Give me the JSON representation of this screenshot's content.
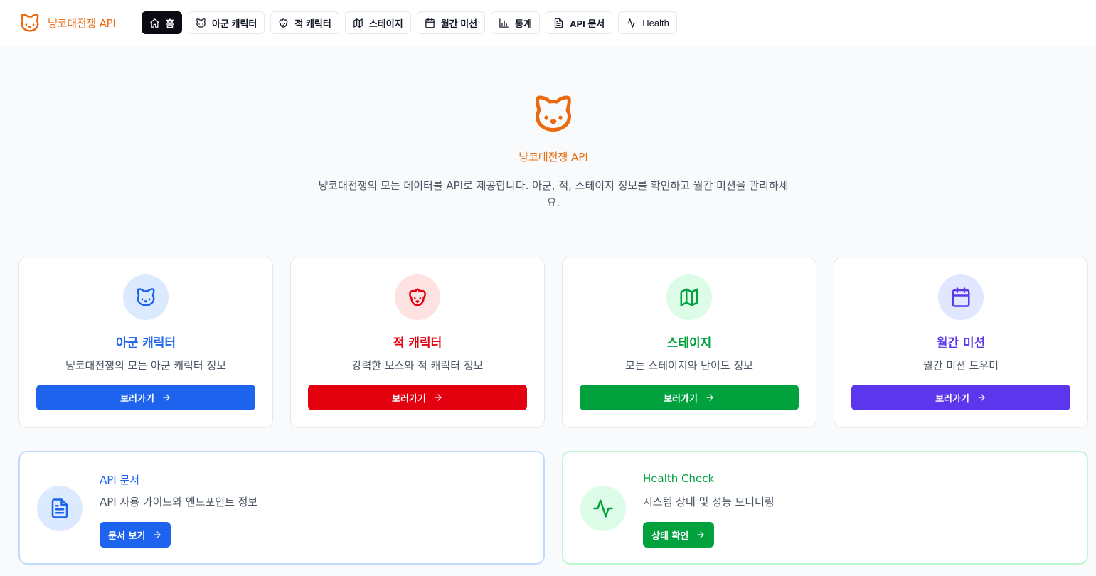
{
  "brand": {
    "name": "냥코대전쟁 API",
    "icon": "cat-icon",
    "color": "#ea6a10"
  },
  "nav": [
    {
      "label": "홈",
      "icon": "home-icon",
      "active": true
    },
    {
      "label": "아군 캐릭터",
      "icon": "cat-icon"
    },
    {
      "label": "적 캐릭터",
      "icon": "dog-icon"
    },
    {
      "label": "스테이지",
      "icon": "map-icon"
    },
    {
      "label": "월간 미션",
      "icon": "calendar-icon"
    },
    {
      "label": "통계",
      "icon": "bar-chart-icon"
    },
    {
      "label": "API 문서",
      "icon": "document-icon"
    },
    {
      "label": "Health",
      "icon": "activity-icon"
    }
  ],
  "hero": {
    "title": "냥코대전쟁 API",
    "description": "냥코대전쟁의 모든 데이터를 API로 제공합니다. 아군, 적, 스테이지 정보를 확인하고 월간 미션을 관리하세요."
  },
  "cards": [
    {
      "title": "아군 캐릭터",
      "description": "냥코대전쟁의 모든 아군 캐릭터 정보",
      "button": "보러가기",
      "icon": "cat-icon",
      "color": "#1d63ed",
      "bg": "#dbeafe"
    },
    {
      "title": "적 캐릭터",
      "description": "강력한 보스와 적 캐릭터 정보",
      "button": "보러가기",
      "icon": "dog-icon",
      "color": "#e3000f",
      "bg": "#fee2e2"
    },
    {
      "title": "스테이지",
      "description": "모든 스테이지와 난이도 정보",
      "button": "보러가기",
      "icon": "map-icon",
      "color": "#01a13e",
      "bg": "#dcfce7"
    },
    {
      "title": "월간 미션",
      "description": "월간 미션 도우미",
      "button": "보러가기",
      "icon": "calendar-icon",
      "color": "#5b36ec",
      "bg": "#e0e7ff"
    }
  ],
  "wide_cards": [
    {
      "title": "API 문서",
      "description": "API 사용 가이드와 엔드포인트 정보",
      "button": "문서 보기",
      "icon": "document-icon",
      "color": "#1d63ed",
      "border": "#bfdbfe",
      "bg": "#dbeafe"
    },
    {
      "title": "Health Check",
      "description": "시스템 상태 및 성능 모니터링",
      "button": "상태 확인",
      "icon": "activity-icon",
      "color": "#01a13e",
      "border": "#bbf7d0",
      "bg": "#dcfce7"
    }
  ]
}
